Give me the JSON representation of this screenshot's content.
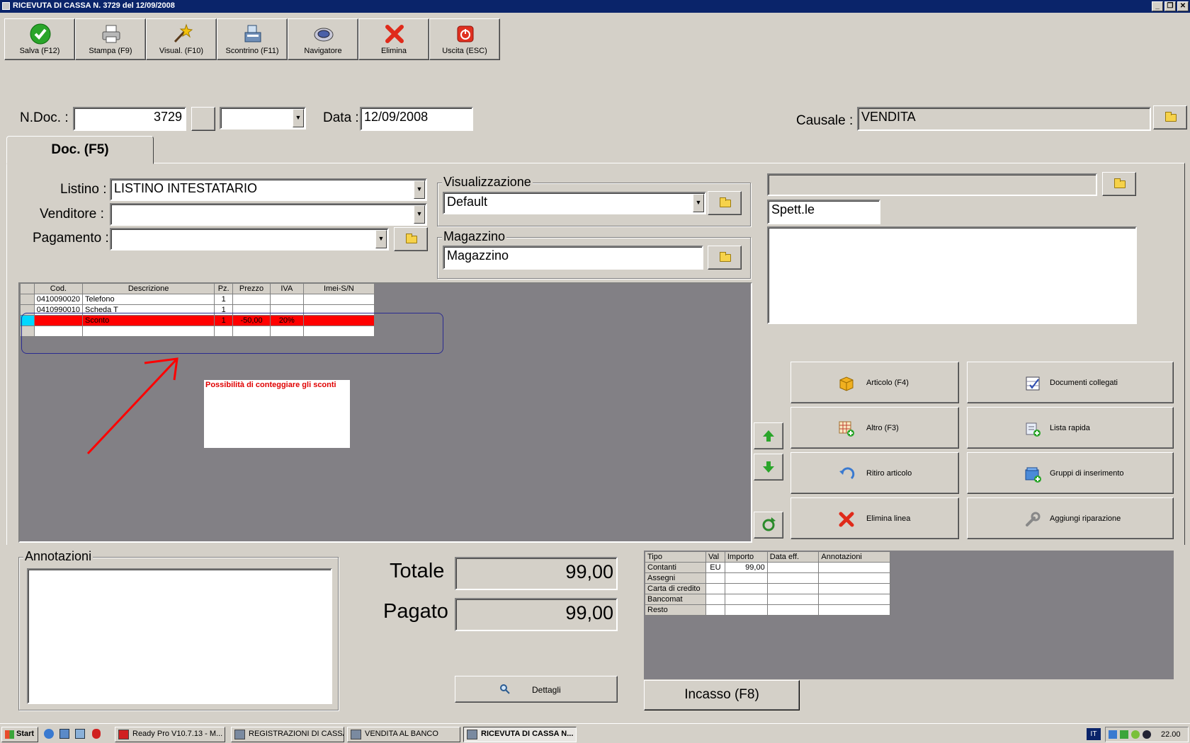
{
  "window": {
    "title": "RICEVUTA DI CASSA N. 3729  del 12/09/2008",
    "controls": [
      "_",
      "❐",
      "✕"
    ]
  },
  "toolbar": [
    {
      "label": "Salva (F12)",
      "icon": "check-icon"
    },
    {
      "label": "Stampa (F9)",
      "icon": "printer-icon"
    },
    {
      "label": "Visual. (F10)",
      "icon": "magic-wand-icon"
    },
    {
      "label": "Scontrino (F11)",
      "icon": "cash-register-icon"
    },
    {
      "label": "Navigatore",
      "icon": "navigator-icon"
    },
    {
      "label": "Elimina",
      "icon": "delete-x-icon"
    },
    {
      "label": "Uscita (ESC)",
      "icon": "power-icon"
    }
  ],
  "header": {
    "ndoc_label": "N.Doc. :",
    "ndoc_value": "3729",
    "data_label": "Data :",
    "data_value": "12/09/2008",
    "causale_label": "Causale :",
    "causale_value": "VENDITA"
  },
  "tab": {
    "label": "Doc. (F5)"
  },
  "form": {
    "listino_label": "Listino :",
    "listino_value": "LISTINO INTESTATARIO",
    "venditore_label": "Venditore :",
    "venditore_value": "",
    "pagamento_label": "Pagamento :",
    "pagamento_value": "",
    "visualizzazione_label": "Visualizzazione",
    "visualizzazione_value": "Default",
    "magazzino_label": "Magazzino",
    "magazzino_value": "Magazzino",
    "spett_value": "Spett.le"
  },
  "grid": {
    "columns": [
      "Cod.",
      "Descrizione",
      "Pz.",
      "Prezzo",
      "IVA",
      "Imei-S/N"
    ],
    "rows": [
      {
        "cod": "0410090020",
        "desc": "Telefono",
        "pz": "1",
        "prezzo": "",
        "iva": "",
        "imei": ""
      },
      {
        "cod": "0410990010",
        "desc": "Scheda T",
        "pz": "1",
        "prezzo": "",
        "iva": "",
        "imei": ""
      },
      {
        "cod": "",
        "desc": "Sconto",
        "pz": "1",
        "prezzo": "-50,00",
        "iva": "20%",
        "imei": ""
      },
      {
        "cod": "",
        "desc": "",
        "pz": "",
        "prezzo": "",
        "iva": "",
        "imei": ""
      }
    ]
  },
  "annotation_note": "Possibilità di conteggiare gli sconti",
  "actions": [
    {
      "label": "Articolo (F4)",
      "icon": "box-icon"
    },
    {
      "label": "Documenti collegati",
      "icon": "checklist-icon"
    },
    {
      "label": "Altro (F3)",
      "icon": "grid-add-icon"
    },
    {
      "label": "Lista rapida",
      "icon": "quick-list-icon"
    },
    {
      "label": "Ritiro articolo",
      "icon": "return-arrow-icon"
    },
    {
      "label": "Gruppi di inserimento",
      "icon": "group-add-icon"
    },
    {
      "label": "Elimina linea",
      "icon": "delete-x-icon"
    },
    {
      "label": "Aggiungi riparazione",
      "icon": "wrench-icon"
    }
  ],
  "annotazioni_label": "Annotazioni",
  "totals": {
    "totale_label": "Totale",
    "totale_value": "99,00",
    "pagato_label": "Pagato",
    "pagato_value": "99,00",
    "dettagli_label": "Dettagli"
  },
  "payments": {
    "columns": [
      "Tipo",
      "Val",
      "Importo",
      "Data eff.",
      "Annotazioni"
    ],
    "rows": [
      {
        "tipo": "Contanti",
        "val": "EU",
        "importo": "99,00"
      },
      {
        "tipo": "Assegni",
        "val": "",
        "importo": ""
      },
      {
        "tipo": "Carta di credito",
        "val": "",
        "importo": ""
      },
      {
        "tipo": "Bancomat",
        "val": "",
        "importo": ""
      },
      {
        "tipo": "Resto",
        "val": "",
        "importo": ""
      }
    ]
  },
  "incasso_label": "Incasso (F8)",
  "taskbar": {
    "start": "Start",
    "tasks": [
      "Ready Pro V10.7.13 - M...",
      "REGISTRAZIONI DI CASSA",
      "VENDITA AL BANCO",
      "RICEVUTA DI CASSA N..."
    ],
    "lang": "IT",
    "clock": "22.00"
  },
  "colors": {
    "title_bar": "#0a246a",
    "selected_row": "#ff0000",
    "grid_bg": "#828085"
  }
}
